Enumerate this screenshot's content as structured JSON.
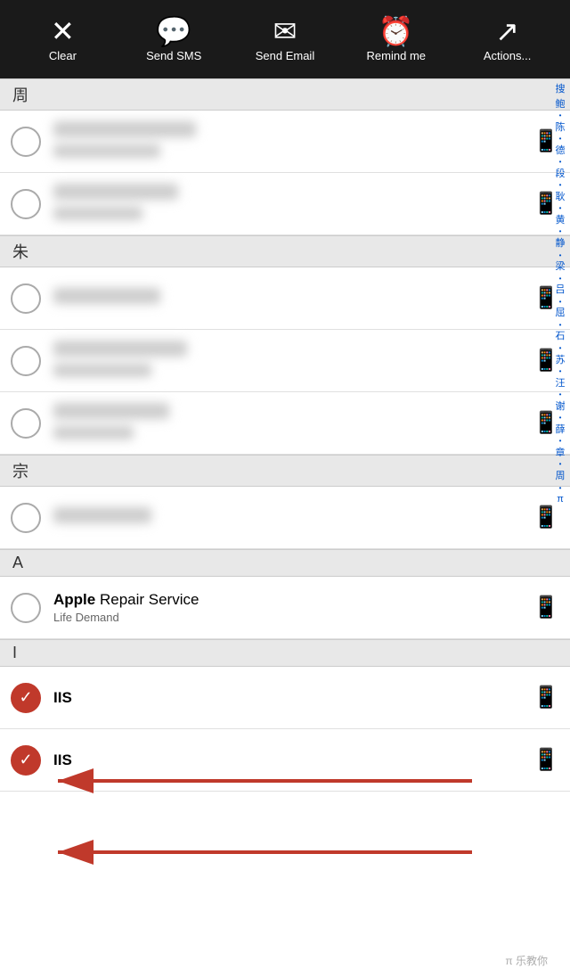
{
  "toolbar": {
    "clear_label": "Clear",
    "clear_icon": "✕",
    "sms_label": "Send SMS",
    "sms_icon": "💬",
    "email_label": "Send Email",
    "email_icon": "✉",
    "remind_label": "Remind me",
    "remind_icon": "⏰",
    "actions_label": "Actions...",
    "actions_icon": "↗"
  },
  "sections": [
    {
      "header": "周",
      "contacts": [
        {
          "id": "c1",
          "blurred": true,
          "checked": false
        },
        {
          "id": "c2",
          "blurred": true,
          "checked": false
        }
      ]
    },
    {
      "header": "朱",
      "contacts": [
        {
          "id": "c3",
          "blurred": true,
          "checked": false
        },
        {
          "id": "c4",
          "blurred": true,
          "checked": false
        },
        {
          "id": "c5",
          "blurred": true,
          "checked": false
        }
      ]
    },
    {
      "header": "宗",
      "contacts": [
        {
          "id": "c6",
          "blurred": true,
          "checked": false
        }
      ]
    },
    {
      "header": "A",
      "contacts": [
        {
          "id": "c7",
          "blurred": false,
          "checked": false,
          "name": "Apple Repair Service",
          "name_bold": "Apple",
          "name_rest": " Repair Service",
          "subtitle": "Life Demand"
        }
      ]
    },
    {
      "header": "I",
      "contacts": [
        {
          "id": "c8",
          "blurred": false,
          "checked": true,
          "name": "IIS",
          "name_bold": "IIS",
          "name_rest": ""
        },
        {
          "id": "c9",
          "blurred": false,
          "checked": true,
          "name": "IIS",
          "name_bold": "IIS",
          "name_rest": ""
        }
      ]
    }
  ],
  "index_sidebar": [
    "搜",
    "鲍",
    "•",
    "陈",
    "•",
    "德",
    "•",
    "段",
    "•",
    "耿",
    "•",
    "黄",
    "•",
    "静",
    "•",
    "梁",
    "•",
    "吕",
    "•",
    "屈",
    "•",
    "石",
    "•",
    "苏",
    "•",
    "汪",
    "•",
    "谢",
    "•",
    "薛",
    "•",
    "章",
    "•",
    "周",
    "•",
    "π"
  ],
  "watermark": "π 乐教你"
}
